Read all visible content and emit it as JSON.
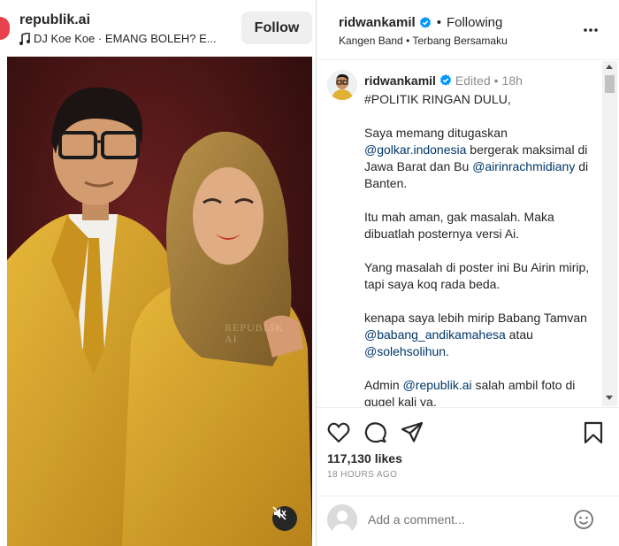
{
  "left": {
    "username": "republik.ai",
    "music": "DJ Koe Koe · EMANG BOLEH? E...",
    "follow_label": "Follow",
    "watermark_line1": "REPUBLIK",
    "watermark_line2": "AI"
  },
  "right": {
    "header": {
      "username": "ridwankamil",
      "dot": "•",
      "following": "Following",
      "subtitle": "Kangen Band • Terbang Bersamaku"
    },
    "caption": {
      "username": "ridwankamil",
      "edited": "Edited",
      "dot": "•",
      "time": "18h",
      "para1": "#POLITIK RINGAN DULU,",
      "para2_before": "Saya memang ditugaskan",
      "para2_mention1": "@golkar.indonesia",
      "para2_middle": "bergerak maksimal di Jawa Barat dan Bu",
      "para2_mention2": "@airinrachmidiany",
      "para2_after": "di Banten.",
      "para3": "Itu mah aman, gak masalah. Maka dibuatlah posternya versi Ai.",
      "para4": "Yang masalah di poster ini Bu Airin mirip, tapi saya koq rada beda.",
      "para5_before": "kenapa saya lebih mirip Babang Tamvan",
      "para5_mention1": "@babang_andikamahesa",
      "para5_middle": "atau",
      "para5_mention2": "@solehsolihun",
      "para5_after": ".",
      "para6_before": "Admin",
      "para6_mention": "@republik.ai",
      "para6_after": "salah ambil foto di gugel kali ya."
    },
    "likes": "117,130 likes",
    "time_ago": "18 HOURS AGO",
    "comment_placeholder": "Add a comment..."
  },
  "colors": {
    "verified_blue": "#0095f6",
    "link_blue": "#00376b",
    "suit_yellow": "#d8a62a",
    "backdrop": "#4a1414"
  },
  "icons": {
    "like": "heart-icon",
    "comment": "comment-icon",
    "share": "share-icon",
    "save": "bookmark-icon",
    "more": "more-icon",
    "mute": "mute-icon",
    "emoji": "emoji-icon",
    "verified": "verified-icon",
    "music": "music-note-icon"
  }
}
